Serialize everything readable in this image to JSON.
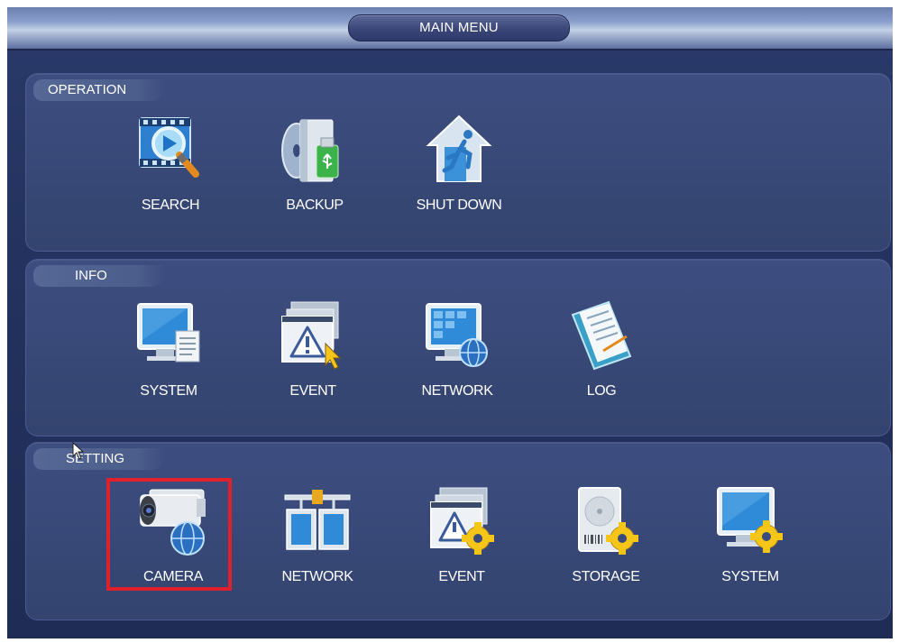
{
  "title": "MAIN MENU",
  "sections": {
    "operation": {
      "label": "OPERATION",
      "items": [
        {
          "label": "SEARCH",
          "icon": "search-icon"
        },
        {
          "label": "BACKUP",
          "icon": "backup-icon"
        },
        {
          "label": "SHUT DOWN",
          "icon": "shutdown-icon"
        }
      ]
    },
    "info": {
      "label": "INFO",
      "items": [
        {
          "label": "SYSTEM",
          "icon": "system-info-icon"
        },
        {
          "label": "EVENT",
          "icon": "event-info-icon"
        },
        {
          "label": "NETWORK",
          "icon": "network-info-icon"
        },
        {
          "label": "LOG",
          "icon": "log-icon"
        }
      ]
    },
    "setting": {
      "label": "SETTING",
      "items": [
        {
          "label": "CAMERA",
          "icon": "camera-icon",
          "selected": true
        },
        {
          "label": "NETWORK",
          "icon": "network-setting-icon"
        },
        {
          "label": "EVENT",
          "icon": "event-setting-icon"
        },
        {
          "label": "STORAGE",
          "icon": "storage-icon"
        },
        {
          "label": "SYSTEM",
          "icon": "system-setting-icon"
        }
      ]
    }
  },
  "colors": {
    "highlight": "#e0202a",
    "background": "#23325e",
    "panel": "#3a4a7c"
  }
}
